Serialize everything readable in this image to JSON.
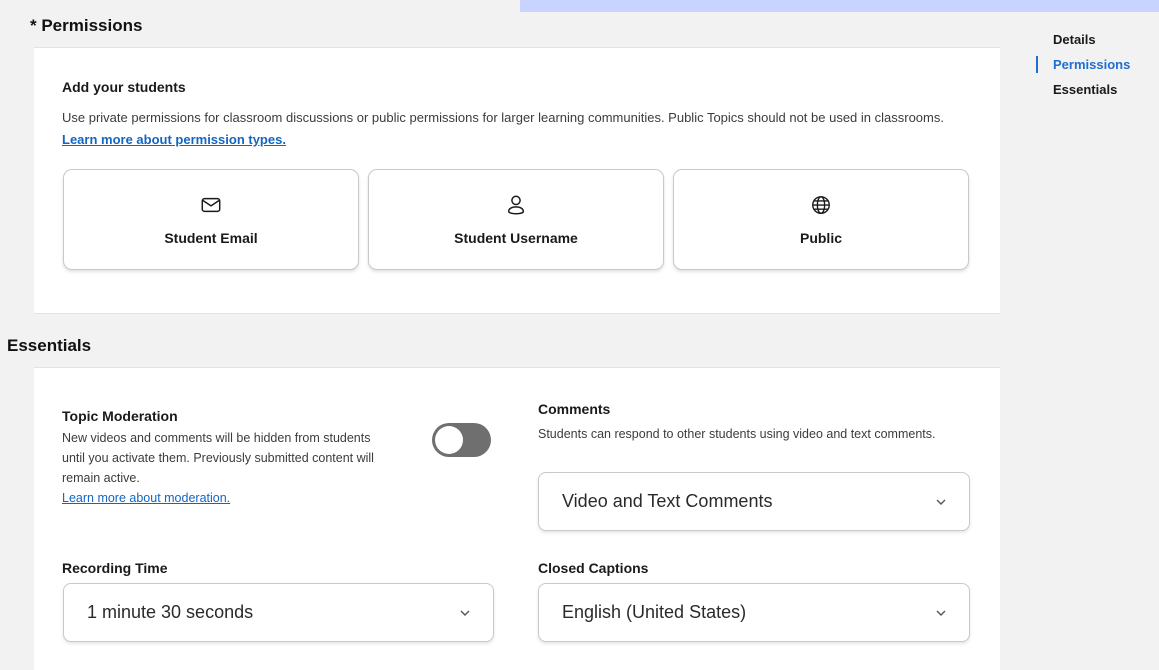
{
  "permissions": {
    "title": "* Permissions",
    "add_students_heading": "Add your students",
    "description": "Use private permissions for classroom discussions or public permissions for larger learning communities. Public Topics should not be used in classrooms.",
    "learn_more_link": "Learn more about permission types.",
    "options": [
      {
        "label": "Student Email",
        "icon": "envelope-icon"
      },
      {
        "label": "Student Username",
        "icon": "user-icon"
      },
      {
        "label": "Public",
        "icon": "globe-icon"
      }
    ]
  },
  "nav": {
    "items": [
      {
        "label": "Details",
        "active": false
      },
      {
        "label": "Permissions",
        "active": true
      },
      {
        "label": "Essentials",
        "active": false
      }
    ]
  },
  "essentials": {
    "title": "Essentials",
    "moderation": {
      "title": "Topic Moderation",
      "description": "New videos and comments will be hidden from students until you activate them. Previously submitted content will remain active.",
      "link": "Learn more about moderation.",
      "enabled": false
    },
    "comments": {
      "title": "Comments",
      "description": "Students can respond to other students using video and text comments.",
      "selected": "Video and Text Comments"
    },
    "recording_time": {
      "title": "Recording Time",
      "selected": "1 minute 30 seconds"
    },
    "closed_captions": {
      "title": "Closed Captions",
      "selected": "English (United States)"
    }
  },
  "colors": {
    "accent": "#1e6fd0",
    "link": "#1565c0",
    "toggle_off": "#6f6f6f",
    "banner": "#c9d3ff"
  }
}
